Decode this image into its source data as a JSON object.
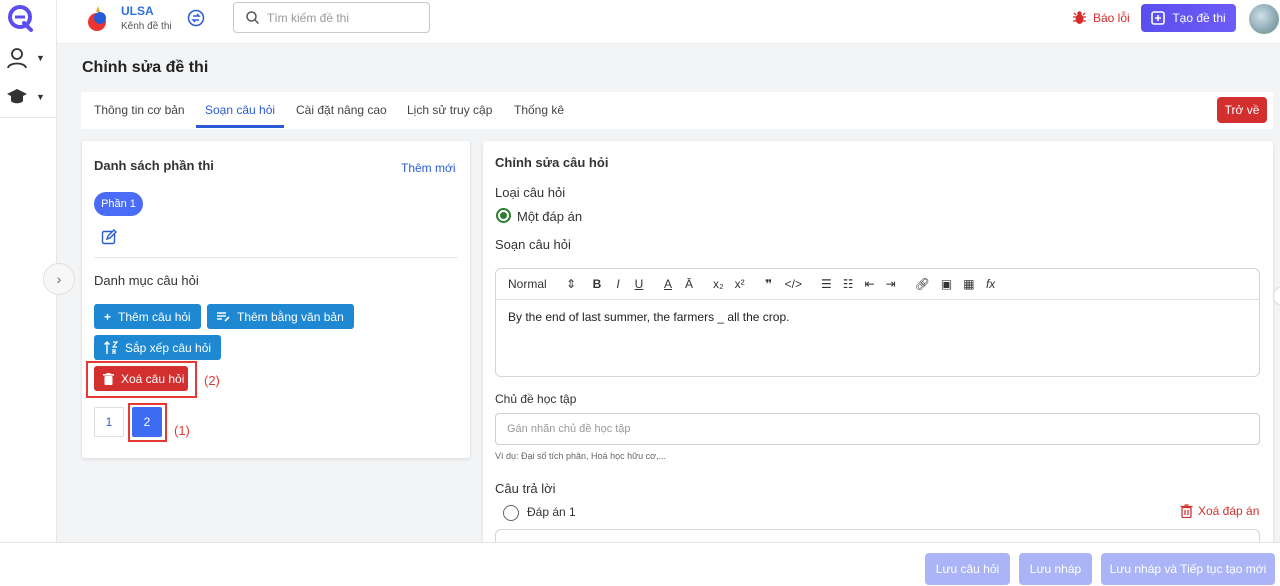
{
  "brand": {
    "name": "ULSA",
    "subtitle": "Kênh đề thi"
  },
  "search": {
    "placeholder": "Tìm kiếm đề thi"
  },
  "header": {
    "report_label": "Báo lỗi",
    "create_label": "Tạo đề thi"
  },
  "page": {
    "title": "Chỉnh sửa đề thi"
  },
  "tabs": [
    {
      "label": "Thông tin cơ bản"
    },
    {
      "label": "Soạn câu hỏi",
      "active": true
    },
    {
      "label": "Cài đặt nâng cao"
    },
    {
      "label": "Lịch sử truy cập"
    },
    {
      "label": "Thống kê"
    }
  ],
  "back_label": "Trở về",
  "sections": {
    "title": "Danh sách phần thi",
    "add_new": "Thêm mới",
    "parts": [
      "Phần 1"
    ],
    "category_title": "Danh mục câu hỏi",
    "add_question": "Thêm câu hỏi",
    "add_by_text": "Thêm bằng văn bản",
    "sort_questions": "Sắp xếp câu hỏi",
    "delete_question": "Xoá câu hỏi",
    "pages": [
      "1",
      "2"
    ],
    "current_page": "2",
    "annotation_1": "(1)",
    "annotation_2": "(2)"
  },
  "editor": {
    "title": "Chỉnh sửa câu hỏi",
    "type_label": "Loại câu hỏi",
    "type_value": "Một đáp án",
    "compose_label": "Soạn câu hỏi",
    "format_select": "Normal",
    "question_text": "By the end of last summer, the farmers _ all the crop.",
    "topic_label": "Chủ đề học tập",
    "topic_placeholder": "Gán nhãn chủ đề học tập",
    "topic_hint": "Ví dụ: Đại số tích phân, Hoá học hữu cơ,...",
    "answers_label": "Câu trả lời",
    "answer_1": "Đáp án 1",
    "delete_answer": "Xoá đáp án"
  },
  "footer": {
    "save_question": "Lưu câu hỏi",
    "save_draft": "Lưu nháp",
    "save_continue": "Lưu nháp và Tiếp tục tạo mới"
  },
  "colors": {
    "primary": "#2a5bd7",
    "danger": "#d32f2f",
    "action": "#1e88d3",
    "create": "#5b4ef0"
  }
}
